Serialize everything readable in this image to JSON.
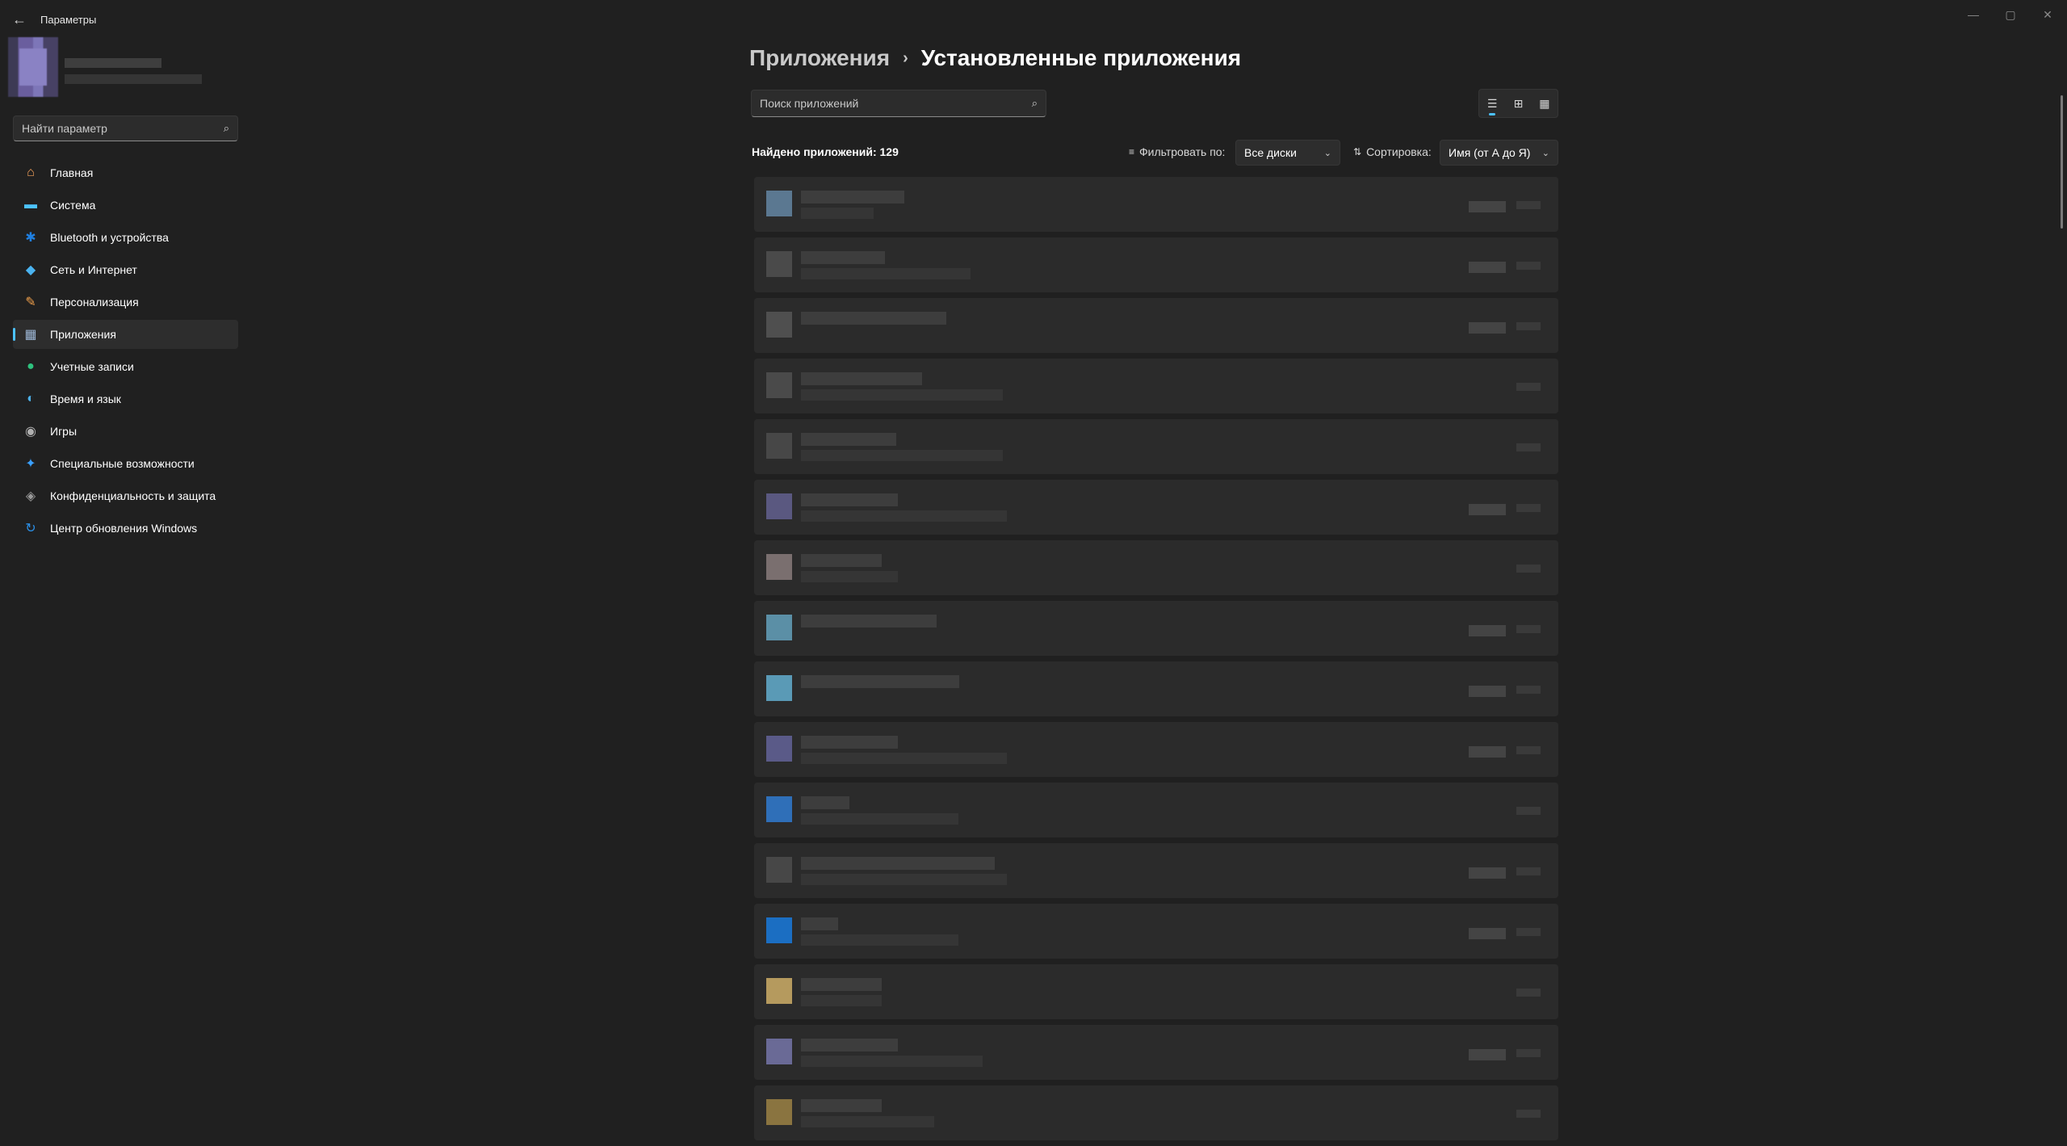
{
  "window": {
    "title": "Параметры",
    "back_icon": "←",
    "minimize_icon": "—",
    "maximize_icon": "▢",
    "close_icon": "✕"
  },
  "sidebar": {
    "search_placeholder": "Найти параметр",
    "search_icon": "⌕",
    "items": [
      {
        "label": "Главная",
        "icon": "⌂",
        "color": "#f7a35c"
      },
      {
        "label": "Система",
        "icon": "▬",
        "color": "#4cc2ff"
      },
      {
        "label": "Bluetooth и устройства",
        "icon": "✱",
        "color": "#1f7fe0"
      },
      {
        "label": "Сеть и Интернет",
        "icon": "◆",
        "color": "#4ab3f0"
      },
      {
        "label": "Персонализация",
        "icon": "✎",
        "color": "#f0a04b"
      },
      {
        "label": "Приложения",
        "icon": "▦",
        "color": "#9db7d6"
      },
      {
        "label": "Учетные записи",
        "icon": "●",
        "color": "#2ec27e"
      },
      {
        "label": "Время и язык",
        "icon": "◐",
        "color": "#4cb0e8"
      },
      {
        "label": "Игры",
        "icon": "◉",
        "color": "#b0b0b0"
      },
      {
        "label": "Специальные возможности",
        "icon": "✦",
        "color": "#3aa0ff"
      },
      {
        "label": "Конфиденциальность и защита",
        "icon": "◈",
        "color": "#9a9a9a"
      },
      {
        "label": "Центр обновления Windows",
        "icon": "↻",
        "color": "#2b8fe6"
      }
    ],
    "active_index": 5
  },
  "main": {
    "breadcrumb_parent": "Приложения",
    "breadcrumb_sep": "›",
    "breadcrumb_current": "Установленные приложения",
    "search_placeholder": "Поиск приложений",
    "found_count": "Найдено приложений: 129",
    "filter_label": "Фильтровать по:",
    "filter_value": "Все диски",
    "sort_label": "Сортировка:",
    "sort_value": "Имя (от А до Я)",
    "view_icons": [
      "☰",
      "⊞",
      "▦"
    ],
    "apps": [
      {
        "icon_color": "#5b7891"
      },
      {
        "icon_color": "#4a4a4a"
      },
      {
        "icon_color": "#4f4f4f"
      },
      {
        "icon_color": "#4a4a4a"
      },
      {
        "icon_color": "#474747"
      },
      {
        "icon_color": "#5a5880"
      },
      {
        "icon_color": "#7a6f6f"
      },
      {
        "icon_color": "#5b8fa6"
      },
      {
        "icon_color": "#5a9ab6"
      },
      {
        "icon_color": "#5a5a88"
      },
      {
        "icon_color": "#2f6fb8"
      },
      {
        "icon_color": "#474747"
      },
      {
        "icon_color": "#1b6ec2"
      },
      {
        "icon_color": "#b59a5e"
      },
      {
        "icon_color": "#6a6a96"
      },
      {
        "icon_color": "#8a7440"
      }
    ]
  }
}
